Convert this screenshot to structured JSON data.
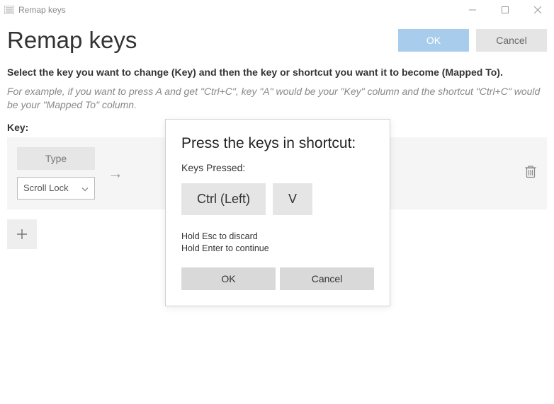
{
  "titlebar": {
    "title": "Remap keys"
  },
  "header": {
    "title": "Remap keys",
    "ok_label": "OK",
    "cancel_label": "Cancel"
  },
  "instructions": {
    "lead": "Select the key you want to change (Key) and then the key or shortcut you want it to become (Mapped To).",
    "example": "For example, if you want to press A and get \"Ctrl+C\", key \"A\" would be your \"Key\" column and the shortcut \"Ctrl+C\" would be your \"Mapped To\" column."
  },
  "columns": {
    "key_label": "Key:"
  },
  "row": {
    "type_label": "Type",
    "selected_key": "Scroll Lock"
  },
  "modal": {
    "title": "Press the keys in shortcut:",
    "subtitle": "Keys Pressed:",
    "keys": [
      "Ctrl (Left)",
      "V"
    ],
    "hint_line1": "Hold Esc to discard",
    "hint_line2": "Hold Enter to continue",
    "ok_label": "OK",
    "cancel_label": "Cancel"
  }
}
